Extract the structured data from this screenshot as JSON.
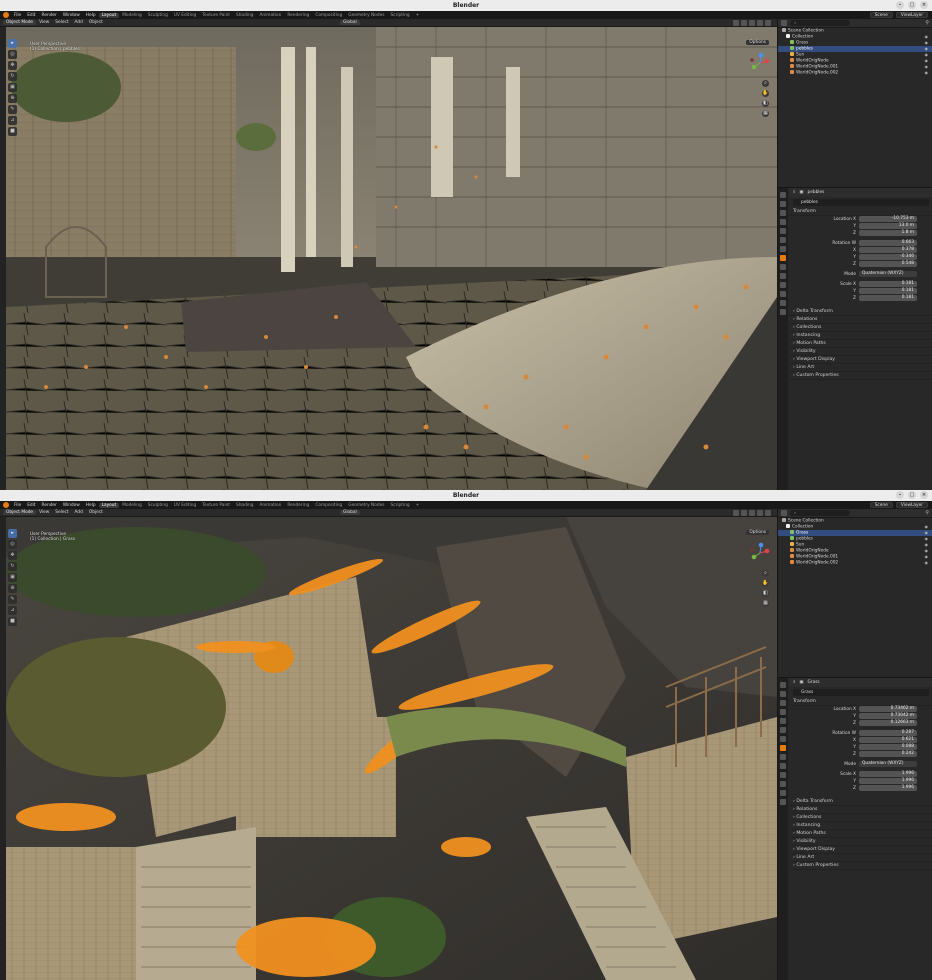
{
  "windows": [
    {
      "title": "Blender",
      "menu": [
        "File",
        "Edit",
        "Render",
        "Window",
        "Help"
      ],
      "workspaces": [
        "Layout",
        "Modeling",
        "Sculpting",
        "UV Editing",
        "Texture Paint",
        "Shading",
        "Animation",
        "Rendering",
        "Compositing",
        "Geometry Nodes",
        "Scripting"
      ],
      "workspace_add": "+",
      "scene": "Scene",
      "view_layer": "ViewLayer",
      "header": {
        "mode": "Object Mode",
        "menus": [
          "View",
          "Select",
          "Add",
          "Object"
        ],
        "orientation": "Global"
      },
      "viewport": {
        "info_line1": "User Perspective",
        "info_line2": "(1) Collection | pebbles",
        "options": "Options"
      },
      "outliner": {
        "rows": [
          {
            "label": "Scene Collection",
            "selected": false
          },
          {
            "label": "Collection",
            "selected": false
          },
          {
            "label": "Grass",
            "selected": false
          },
          {
            "label": "pebbles",
            "selected": true
          },
          {
            "label": "Sun",
            "selected": false
          },
          {
            "label": "WorldOrigNode",
            "selected": false
          },
          {
            "label": "WorldOrigNode.001",
            "selected": false
          },
          {
            "label": "WorldOrigNode.002",
            "selected": false
          }
        ]
      },
      "properties": {
        "object_tab": "pebbles",
        "object_name": "pebbles",
        "transform_label": "Transform",
        "rows": [
          {
            "label": "Location X",
            "value": "-10.753 m"
          },
          {
            "label": "Y",
            "value": "13.0 m"
          },
          {
            "label": "Z",
            "value": "1.8 m"
          },
          {
            "label": "Rotation W",
            "value": "0.663"
          },
          {
            "label": "X",
            "value": "0.378"
          },
          {
            "label": "Y",
            "value": "-0.346"
          },
          {
            "label": "Z",
            "value": "0.548"
          },
          {
            "label": "Mode",
            "value": "Quaternion (WXYZ)"
          },
          {
            "label": "Scale X",
            "value": "0.181"
          },
          {
            "label": "Y",
            "value": "0.181"
          },
          {
            "label": "Z",
            "value": "0.181"
          }
        ],
        "sections": [
          "Delta Transform",
          "Relations",
          "Collections",
          "Instancing",
          "Motion Paths",
          "Visibility",
          "Viewport Display",
          "Line Art",
          "Custom Properties"
        ]
      }
    },
    {
      "title": "Blender",
      "menu": [
        "File",
        "Edit",
        "Render",
        "Window",
        "Help"
      ],
      "workspaces": [
        "Layout",
        "Modeling",
        "Sculpting",
        "UV Editing",
        "Texture Paint",
        "Shading",
        "Animation",
        "Rendering",
        "Compositing",
        "Geometry Nodes",
        "Scripting"
      ],
      "workspace_add": "+",
      "scene": "Scene",
      "view_layer": "ViewLayer",
      "header": {
        "mode": "Object Mode",
        "menus": [
          "View",
          "Select",
          "Add",
          "Object"
        ],
        "orientation": "Global"
      },
      "viewport": {
        "info_line1": "User Perspective",
        "info_line2": "(1) Collection | Grass",
        "options": "Options"
      },
      "outliner": {
        "rows": [
          {
            "label": "Scene Collection",
            "selected": false
          },
          {
            "label": "Collection",
            "selected": false
          },
          {
            "label": "Grass",
            "selected": true
          },
          {
            "label": "pebbles",
            "selected": false
          },
          {
            "label": "Sun",
            "selected": false
          },
          {
            "label": "WorldOrigNode",
            "selected": false
          },
          {
            "label": "WorldOrigNode.001",
            "selected": false
          },
          {
            "label": "WorldOrigNode.002",
            "selected": false
          }
        ]
      },
      "properties": {
        "object_tab": "Grass",
        "object_name": "Grass",
        "transform_label": "Transform",
        "rows": [
          {
            "label": "Location X",
            "value": "0.73462 m"
          },
          {
            "label": "Y",
            "value": "0.73042 m"
          },
          {
            "label": "Z",
            "value": "0.12663 m"
          },
          {
            "label": "Rotation W",
            "value": "0.287"
          },
          {
            "label": "X",
            "value": "0.621"
          },
          {
            "label": "Y",
            "value": "0.088"
          },
          {
            "label": "Z",
            "value": "0.242"
          },
          {
            "label": "Mode",
            "value": "Quaternion (WXYZ)"
          },
          {
            "label": "Scale X",
            "value": "1.996"
          },
          {
            "label": "Y",
            "value": "1.996"
          },
          {
            "label": "Z",
            "value": "1.996"
          }
        ],
        "sections": [
          "Delta Transform",
          "Relations",
          "Collections",
          "Instancing",
          "Motion Paths",
          "Visibility",
          "Viewport Display",
          "Line Art",
          "Custom Properties"
        ]
      }
    }
  ],
  "colors": {
    "accent": "#4772b3",
    "brand": "#e87d0d",
    "selection": "#334d80"
  },
  "icons": [
    "blender-logo-icon",
    "search-icon",
    "eye-icon",
    "camera-icon",
    "move-icon",
    "rotate-icon",
    "scale-icon",
    "cursor-icon",
    "select-box-icon",
    "grab-hand-icon",
    "zoom-icon",
    "collection-icon",
    "mesh-icon",
    "light-icon",
    "empty-icon"
  ]
}
